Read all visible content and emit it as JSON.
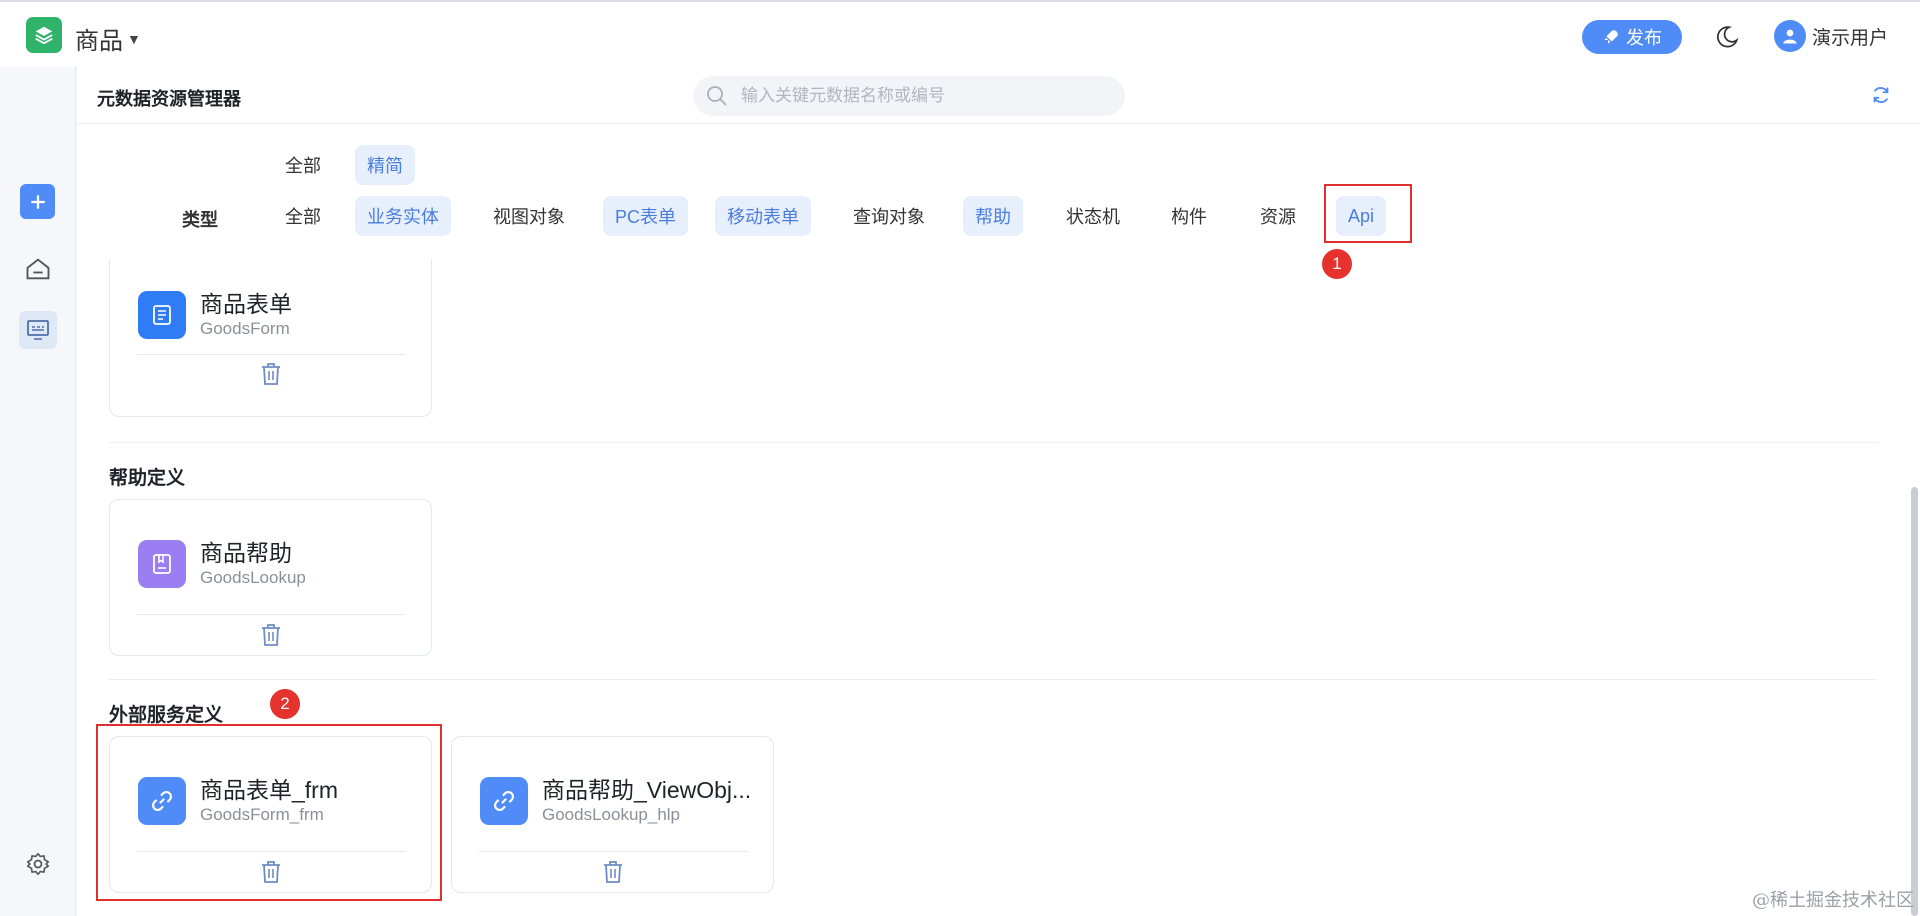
{
  "topbar": {
    "app_name": "商品",
    "caret": "▼",
    "publish_label": "发布",
    "user_name": "演示用户"
  },
  "main": {
    "title": "元数据资源管理器",
    "search_placeholder": "输入关键元数据名称或编号"
  },
  "mode_filters": [
    {
      "label": "全部",
      "active": false
    },
    {
      "label": "精简",
      "active": true
    }
  ],
  "type_filter": {
    "label": "类型",
    "options": [
      {
        "label": "全部",
        "active": false
      },
      {
        "label": "业务实体",
        "active": true
      },
      {
        "label": "视图对象",
        "active": false
      },
      {
        "label": "PC表单",
        "active": true
      },
      {
        "label": "移动表单",
        "active": true
      },
      {
        "label": "查询对象",
        "active": false
      },
      {
        "label": "帮助",
        "active": true
      },
      {
        "label": "状态机",
        "active": false
      },
      {
        "label": "构件",
        "active": false
      },
      {
        "label": "资源",
        "active": false
      },
      {
        "label": "Api",
        "active": true
      }
    ]
  },
  "annotations": {
    "badge_1": "1",
    "badge_2": "2"
  },
  "sections": [
    {
      "title": "",
      "cards": [
        {
          "name": "商品表单",
          "code": "GoodsForm",
          "icon": "form-icon",
          "color": "#2f7cf6"
        }
      ]
    },
    {
      "title": "帮助定义",
      "cards": [
        {
          "name": "商品帮助",
          "code": "GoodsLookup",
          "icon": "lookup-icon",
          "color": "#9b7ef3"
        }
      ]
    },
    {
      "title": "外部服务定义",
      "cards": [
        {
          "name": "商品表单_frm",
          "code": "GoodsForm_frm",
          "icon": "link-icon",
          "color": "#4f8cf7"
        },
        {
          "name": "商品帮助_ViewObj...",
          "code": "GoodsLookup_hlp",
          "icon": "link-icon",
          "color": "#4f8cf7"
        }
      ]
    }
  ],
  "watermark": "@稀土掘金技术社区"
}
